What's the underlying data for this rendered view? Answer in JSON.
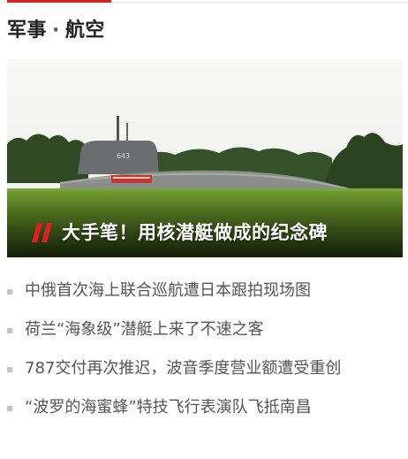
{
  "colors": {
    "accent": "#e02020",
    "bullet": "#c4c4c4",
    "list_text": "#555555",
    "title_text": "#222222"
  },
  "section": {
    "title_main": "军事",
    "separator": "·",
    "title_sub": "航空"
  },
  "hero": {
    "caption": "大手笔！用核潜艇做成的纪念碑",
    "caption_icon": "double-slash-quote-icon",
    "sail_number": "643"
  },
  "news": [
    {
      "title": "中俄首次海上联合巡航遭日本跟拍现场图"
    },
    {
      "title": "荷兰“海象级”潜艇上来了不速之客"
    },
    {
      "title": "787交付再次推迟，波音季度营业额遭受重创"
    },
    {
      "title": "“波罗的海蜜蜂”特技飞行表演队飞抵南昌"
    }
  ]
}
